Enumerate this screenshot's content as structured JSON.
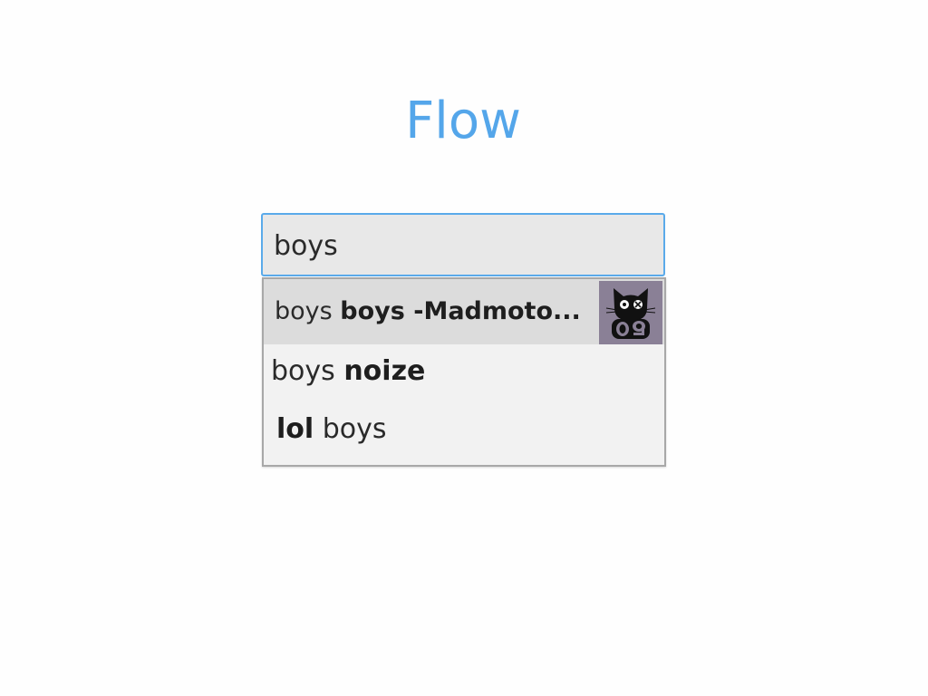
{
  "app": {
    "title": "Flow",
    "accent_color": "#54a6ea"
  },
  "search": {
    "value": "boys"
  },
  "suggestions": [
    {
      "prefix": "boys",
      "bold": "boys -Madmoto...",
      "has_thumbnail": true,
      "thumbnail_icon": "black-cat-09-album-art",
      "selected": true
    },
    {
      "prefix": "boys",
      "bold": "noize",
      "selected": false
    },
    {
      "bold": "lol",
      "suffix": "boys",
      "selected": false
    }
  ]
}
